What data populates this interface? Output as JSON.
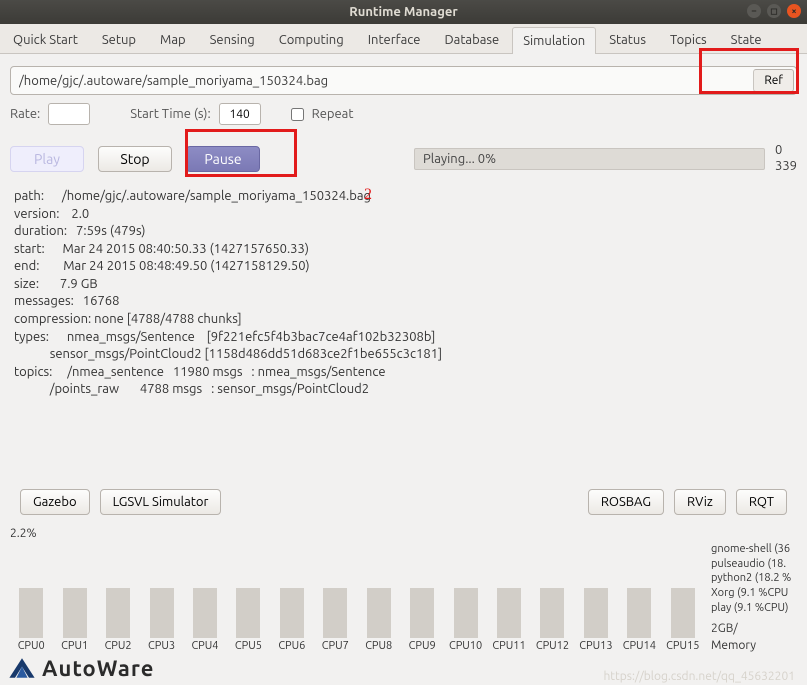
{
  "window": {
    "title": "Runtime Manager"
  },
  "tabs": [
    "Quick Start",
    "Setup",
    "Map",
    "Sensing",
    "Computing",
    "Interface",
    "Database",
    "Simulation",
    "Status",
    "Topics",
    "State"
  ],
  "active_tab": "Simulation",
  "bag": {
    "path": "/home/gjc/.autoware/sample_moriyama_150324.bag",
    "ref_label": "Ref",
    "rate_label": "Rate:",
    "rate_value": "",
    "start_time_label": "Start Time (s):",
    "start_time_value": "140",
    "repeat_label": "Repeat"
  },
  "controls": {
    "play": "Play",
    "stop": "Stop",
    "pause": "Pause",
    "playing_text": "Playing... 0%",
    "count_top": "0",
    "count_bottom": "339"
  },
  "info": {
    "line1": "path:      /home/gjc/.autoware/sample_moriyama_150324.bag",
    "line2": "version:    2.0",
    "line3": "duration:   7:59s (479s)",
    "line4": "start:      Mar 24 2015 08:40:50.33 (1427157650.33)",
    "line5": "end:        Mar 24 2015 08:48:49.50 (1427158129.50)",
    "line6": "size:       7.9 GB",
    "line7": "messages:   16768",
    "line8": "compression: none [4788/4788 chunks]",
    "line9": "types:      nmea_msgs/Sentence    [9f221efc5f4b3bac7ce4af102b32308b]",
    "line10": "            sensor_msgs/PointCloud2 [1158d486dd51d683ce2f1be655c3c181]",
    "line11": "topics:     /nmea_sentence   11980 msgs   : nmea_msgs/Sentence",
    "line12": "            /points_raw       4788 msgs   : sensor_msgs/PointCloud2"
  },
  "annotation": {
    "num2": "2"
  },
  "bottom": {
    "gazebo": "Gazebo",
    "lgsvl": "LGSVL Simulator",
    "rosbag": "ROSBAG",
    "rviz": "RViz",
    "rqt": "RQT"
  },
  "cpu": {
    "overall_pct": "2.2%",
    "cores": [
      "CPU0",
      "CPU1",
      "CPU2",
      "CPU3",
      "CPU4",
      "CPU5",
      "CPU6",
      "CPU7",
      "CPU8",
      "CPU9",
      "CPU10",
      "CPU11",
      "CPU12",
      "CPU13",
      "CPU14",
      "CPU15"
    ],
    "bar_heights_pct": [
      60,
      60,
      60,
      60,
      60,
      60,
      60,
      60,
      60,
      60,
      60,
      60,
      60,
      60,
      60,
      60
    ],
    "procs": [
      "gnome-shell (36",
      "pulseaudio (18.",
      "python2 (18.2 %",
      "Xorg (9.1 %CPU",
      "play (9.1 %CPU)"
    ],
    "mem_text": "2GB/",
    "mem_label": "Memory"
  },
  "footer": {
    "brand": "AutoWare",
    "watermark": "https://blog.csdn.net/qq_45632201"
  }
}
